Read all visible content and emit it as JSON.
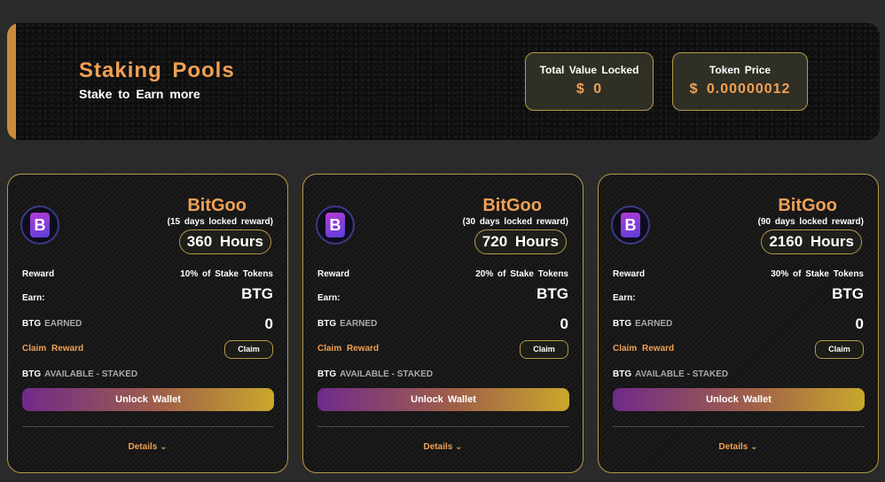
{
  "header": {
    "title": "Staking  Pools",
    "subtitle": "Stake  to  Earn  more",
    "tvl_label": "Total  Value  Locked",
    "tvl_value": "$  0",
    "price_label": "Token  Price",
    "price_value": "$  0.00000012",
    "accent_color": "#c98a3b"
  },
  "pools": [
    {
      "name": "BitGoo",
      "lock_note": "(15  days  locked  reward)",
      "hours": "360  Hours",
      "reward_label": "Reward",
      "reward_value": "10%  of  Stake  Tokens",
      "earn_label": "Earn:",
      "earn_value": "BTG",
      "earned_token": "BTG",
      "earned_label": "EARNED",
      "earned_value": "0",
      "claim_reward_label": "Claim  Reward",
      "claim_button": "Claim",
      "available_token": "BTG",
      "available_label": "AVAILABLE  -  STAKED",
      "unlock_button": "Unlock  Wallet",
      "details_label": "Details ⌄",
      "logo_icon": "bitgoo-logo-icon"
    },
    {
      "name": "BitGoo",
      "lock_note": "(30  days  locked  reward)",
      "hours": "720  Hours",
      "reward_label": "Reward",
      "reward_value": "20%  of  Stake  Tokens",
      "earn_label": "Earn:",
      "earn_value": "BTG",
      "earned_token": "BTG",
      "earned_label": "EARNED",
      "earned_value": "0",
      "claim_reward_label": "Claim  Reward",
      "claim_button": "Claim",
      "available_token": "BTG",
      "available_label": "AVAILABLE  -  STAKED",
      "unlock_button": "Unlock  Wallet",
      "details_label": "Details ⌄",
      "logo_icon": "bitgoo-logo-icon"
    },
    {
      "name": "BitGoo",
      "lock_note": "(90  days  locked  reward)",
      "hours": "2160  Hours",
      "reward_label": "Reward",
      "reward_value": "30%  of  Stake  Tokens",
      "earn_label": "Earn:",
      "earn_value": "BTG",
      "earned_token": "BTG",
      "earned_label": "EARNED",
      "earned_value": "0",
      "claim_reward_label": "Claim  Reward",
      "claim_button": "Claim",
      "available_token": "BTG",
      "available_label": "AVAILABLE  -  STAKED",
      "unlock_button": "Unlock  Wallet",
      "details_label": "Details ⌄",
      "logo_icon": "bitgoo-logo-icon"
    }
  ],
  "colors": {
    "accent": "#f0a055",
    "border_gold": "#b49a44",
    "unlock_gradient_start": "#6f2a8a",
    "unlock_gradient_end": "#c9a82c"
  }
}
